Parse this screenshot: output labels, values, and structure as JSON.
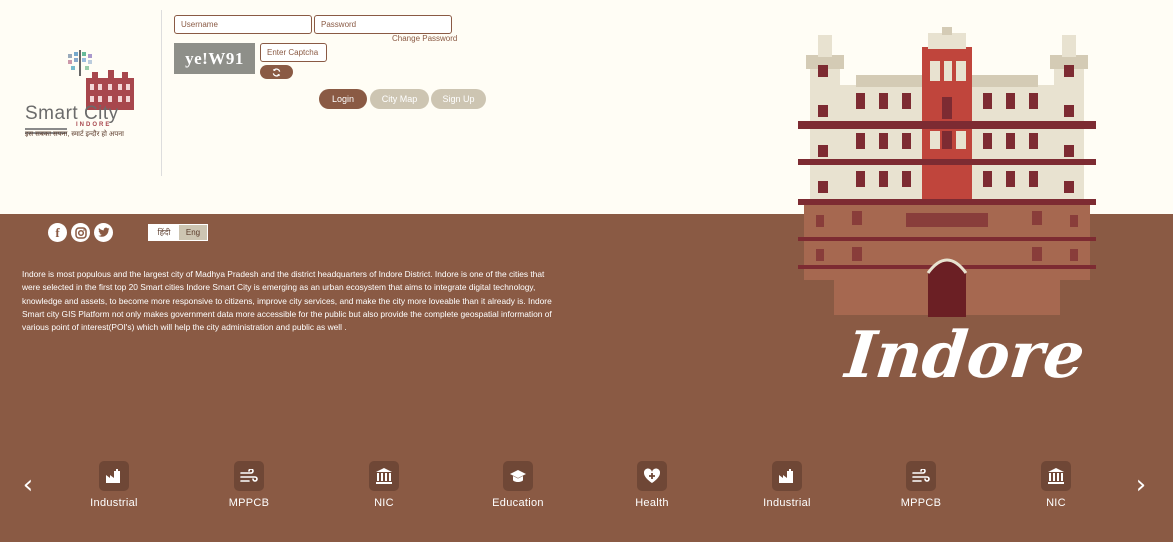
{
  "logo": {
    "name": "Smart City",
    "city": "INDORE",
    "tagline": "इस सबका सपना, स्मार्ट इन्दौर हो अपना"
  },
  "login": {
    "username_placeholder": "Username",
    "password_placeholder": "Password",
    "change_password": "Change Password",
    "captcha_text": "ye!W91",
    "captcha_placeholder": "Enter Captcha"
  },
  "buttons": {
    "login": "Login",
    "city_map": "City Map",
    "sign_up": "Sign Up"
  },
  "language": {
    "hindi": "हिंदी",
    "english": "Eng"
  },
  "about": "Indore is most populous and the largest city of Madhya Pradesh and the district headquarters of Indore District. Indore is one of the cities that were selected in the first top 20 Smart cities Indore Smart City is emerging as an urban ecosystem that aims to integrate digital technology, knowledge and assets, to become more responsive to citizens, improve city services, and make the city more loveable than it already is. Indore Smart city GIS Platform not only makes government data more accessible for the public but also provide the complete geospatial information of various point of interest(POI's) which will help the city administration and public as well .",
  "city_title": "Indore",
  "carousel": {
    "items": [
      {
        "label": "Industrial",
        "icon": "factory-icon"
      },
      {
        "label": "MPPCB",
        "icon": "wind-icon"
      },
      {
        "label": "NIC",
        "icon": "institution-icon"
      },
      {
        "label": "Education",
        "icon": "graduation-cap-icon"
      },
      {
        "label": "Health",
        "icon": "health-heart-icon"
      },
      {
        "label": "Industrial",
        "icon": "factory-icon"
      },
      {
        "label": "MPPCB",
        "icon": "wind-icon"
      },
      {
        "label": "NIC",
        "icon": "institution-icon"
      }
    ]
  },
  "colors": {
    "brand_brown": "#8a5a44",
    "icon_bg": "#6f4736",
    "top_bg": "#fffdf5",
    "secondary_button": "#cdc5b2"
  }
}
